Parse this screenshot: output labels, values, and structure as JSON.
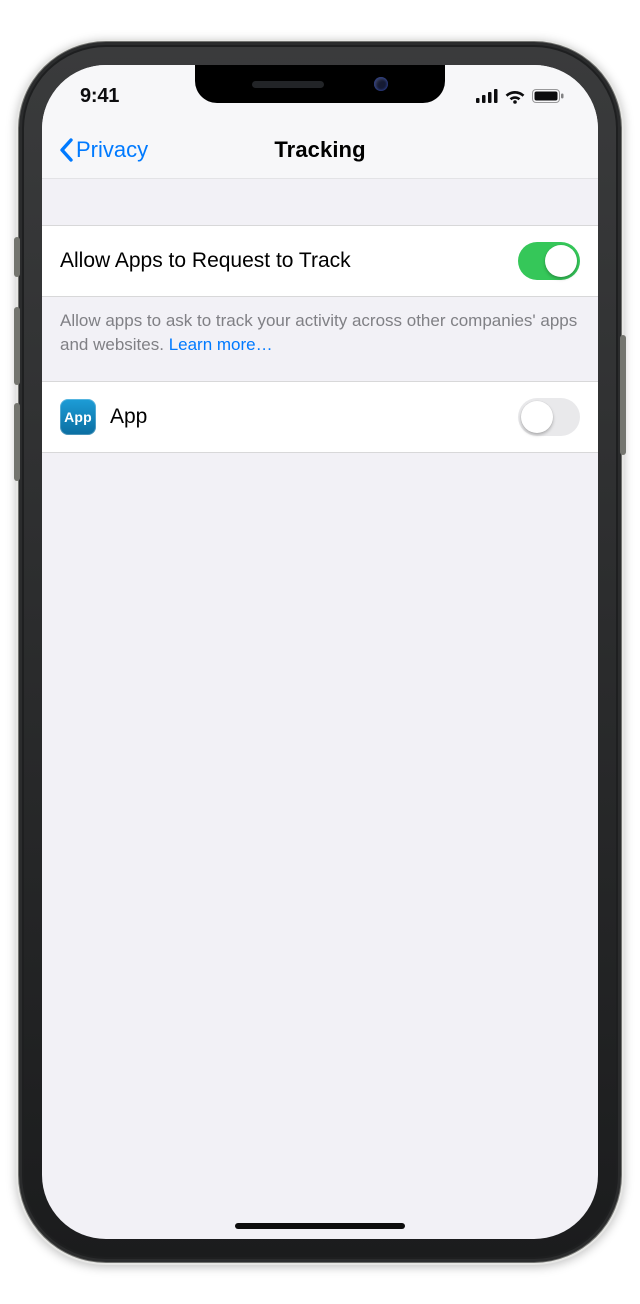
{
  "statusbar": {
    "time": "9:41"
  },
  "nav": {
    "back_label": "Privacy",
    "title": "Tracking"
  },
  "main_toggle": {
    "label": "Allow Apps to Request to Track",
    "on": true
  },
  "footer": {
    "text": "Allow apps to ask to track your activity across other companies' apps and websites. ",
    "link": "Learn more…"
  },
  "apps": [
    {
      "icon_label": "App",
      "name": "App",
      "tracking_on": false
    }
  ]
}
